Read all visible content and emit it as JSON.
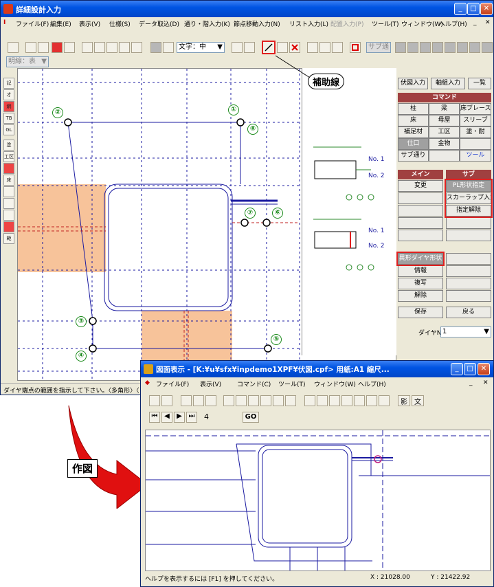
{
  "main_window": {
    "title": "詳細設計入力",
    "menu": [
      "ファイル(F)",
      "編集(E)",
      "表示(V)",
      "仕様(S)",
      "データ取込(D)",
      "通り・階入力(K)",
      "節点移動入力(N)",
      "リスト入力(L)",
      "配置入力(P)",
      "ツール(T)",
      "ウィンドウ(W)",
      "ヘルプ(H)"
    ],
    "toolbar": {
      "text_combo": "文字：中",
      "sub_label": "サブ通"
    },
    "layer_combo": "明線：表",
    "callout": "補助線",
    "status": "ダイヤ端点の範囲を指示して下さい。〈多角形〉〈"
  },
  "left_tools": [
    "記",
    "才",
    "網",
    "TB",
    "GL",
    "塗",
    "工区",
    "",
    "床",
    "",
    "",
    "",
    "",
    "範"
  ],
  "node_labels": [
    "①",
    "②",
    "③",
    "④",
    "⑤",
    "⑥",
    "⑦",
    "⑧"
  ],
  "preview": {
    "labels": [
      "No. 1",
      "No. 2",
      "No. 1",
      "No. 2"
    ]
  },
  "panel": {
    "top_buttons": [
      "伏図入力",
      "軸組入力",
      "一覧"
    ],
    "command_header": "コマンド",
    "commands": [
      "柱",
      "梁",
      "床ブレース",
      "床",
      "母屋",
      "スリーブ",
      "補足材",
      "工区",
      "塗・耐",
      "仕口",
      "金物",
      "",
      "サブ通り",
      "",
      "ツール"
    ],
    "main_header": "メイン",
    "sub_header": "サブ",
    "main_buttons": [
      "変更",
      "",
      "",
      "",
      "",
      "異形ダイヤ形状",
      "情報",
      "複写",
      "解除"
    ],
    "sub_buttons": [
      "PL形状指定",
      "スカーラップ入力",
      "指定解除",
      "",
      "",
      "",
      "",
      "",
      ""
    ],
    "save": "保存",
    "back": "戻る",
    "dia_label": "ダイヤNo",
    "dia_value": "1"
  },
  "arrow_label": "作図",
  "preview_window": {
    "title": "図面表示 - [K:¥u¥sfx¥inpdemo1XPF¥伏図.cpf> 用紙:A1 縮尺...",
    "menu": [
      "ファイル(F)",
      "表示(V)",
      "コマンド(C)",
      "ツール(T)",
      "ウィンドウ(W)",
      "ヘルプ(H)"
    ],
    "page_value": "4",
    "go_label": "GO",
    "right_buttons": [
      "影",
      "文"
    ],
    "status": "ヘルプを表示するには [F1] を押してください。",
    "x_coord": "X : 21028.00",
    "y_coord": "Y : 21422.92"
  },
  "colors": {
    "title": "#0054e3",
    "accent_red": "#e02020",
    "member_fill": "#f7c39a",
    "grid_blue": "#1a1aa0"
  }
}
